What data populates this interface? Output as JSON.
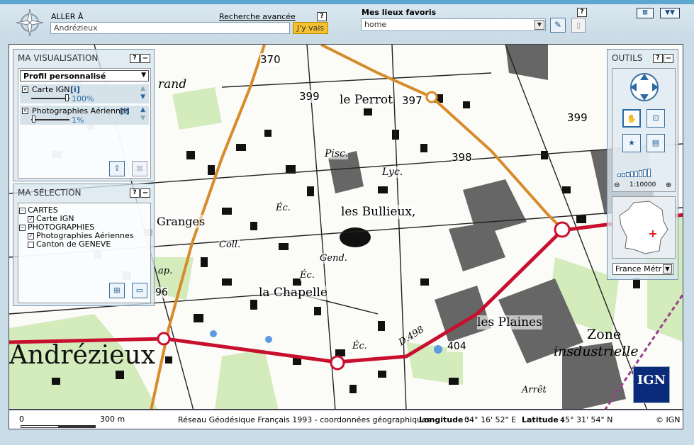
{
  "header": {
    "aller_label": "ALLER À",
    "aller_value": "Andrézieux",
    "advanced_search": "Recherche avancée",
    "help": "?",
    "go_button": "J'y vais",
    "favorites_label": "Mes lieux favoris",
    "favorites_value": "home",
    "win_buttons": [
      "⊠",
      "▼▼"
    ]
  },
  "visualisation": {
    "title": "MA VISUALISATION",
    "profile": "Profil personnalisé",
    "layers": [
      {
        "name": "Carte IGN",
        "info": "[i]",
        "opacity": "100%"
      },
      {
        "name": "Photographies Aériennes",
        "info": "[i]",
        "opacity": "1%"
      }
    ]
  },
  "selection": {
    "title": "MA SÉLECTION",
    "tree": [
      {
        "label": "CARTES",
        "level": 0,
        "kind": "folder"
      },
      {
        "label": "Carte IGN",
        "level": 1,
        "kind": "checked"
      },
      {
        "label": "PHOTOGRAPHIES",
        "level": 0,
        "kind": "folder"
      },
      {
        "label": "Photographies Aériennes",
        "level": 1,
        "kind": "checked"
      },
      {
        "label": "Canton de GENEVE",
        "level": 1,
        "kind": "unchecked"
      }
    ]
  },
  "outils": {
    "title": "OUTILS",
    "scale": "1:10000",
    "region": "France Métr"
  },
  "map_labels": {
    "town": "Andrézieux",
    "zone1": "Zone",
    "zone2": "insdustrielle",
    "plaines": "les Plaines",
    "bullieux": "les Bullieux,",
    "chapelle": "la Chapelle",
    "perrot": "le Perrot",
    "granges": "Granges",
    "arret": "Arrêt",
    "piscine": "Pisc.",
    "lycee": "Lyc.",
    "college": "Coll.",
    "gend": "Gend.",
    "ec1": "Éc.",
    "ec2": "Éc.",
    "ec3": "Éc.",
    "road": "D.498",
    "e370": "370",
    "e399a": "399",
    "e397": "397",
    "e399b": "399",
    "e398": "398",
    "e404": "404",
    "e96": "96",
    "grand": "rand",
    "cap": "ap."
  },
  "footer": {
    "scale_zero": "0",
    "scale_300": "300 m",
    "datum": "Réseau Géodésique Français 1993 - coordonnées géographiques",
    "longitude_label": "Longitude :",
    "longitude_value": "04° 16' 52\" E",
    "latitude_label": "Latitude :",
    "latitude_value": "45° 31' 54\" N",
    "copyright": "© IGN"
  },
  "logo_text": "IGN"
}
